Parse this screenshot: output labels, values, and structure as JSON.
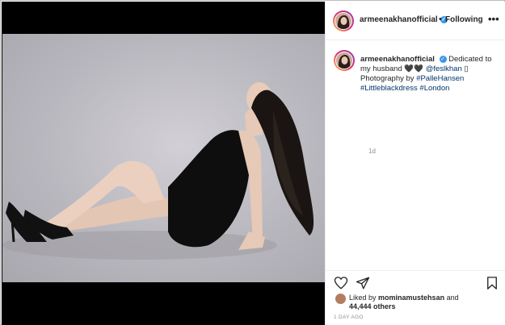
{
  "post": {
    "username": "armeenakhanofficial",
    "follow_status": "Following",
    "more_glyph": "•••",
    "dot_sep": "•",
    "caption": {
      "username": "armeenakhanofficial",
      "text_1": "Dedicated to my husband",
      "hearts": "🖤🖤",
      "mention": "@feslkhan",
      "tail_glyph": "▯",
      "text_2": "Photography by",
      "tag_1": "#PalleHansen",
      "tag_2": "#Littleblackdress",
      "tag_3": "#London",
      "age": "1d"
    },
    "likes": {
      "prefix": "Liked by",
      "user": "mominamustehsan",
      "and": "and",
      "count": "44,444 others"
    },
    "date": "1 DAY AGO",
    "verified_glyph": "✓"
  },
  "colors": {
    "verified": "#3897f0",
    "link": "#00376b",
    "muted": "#8e8e8e"
  },
  "icons": {
    "like": "heart-icon",
    "share": "paper-plane-icon",
    "save": "bookmark-icon",
    "more": "more-options-icon"
  }
}
